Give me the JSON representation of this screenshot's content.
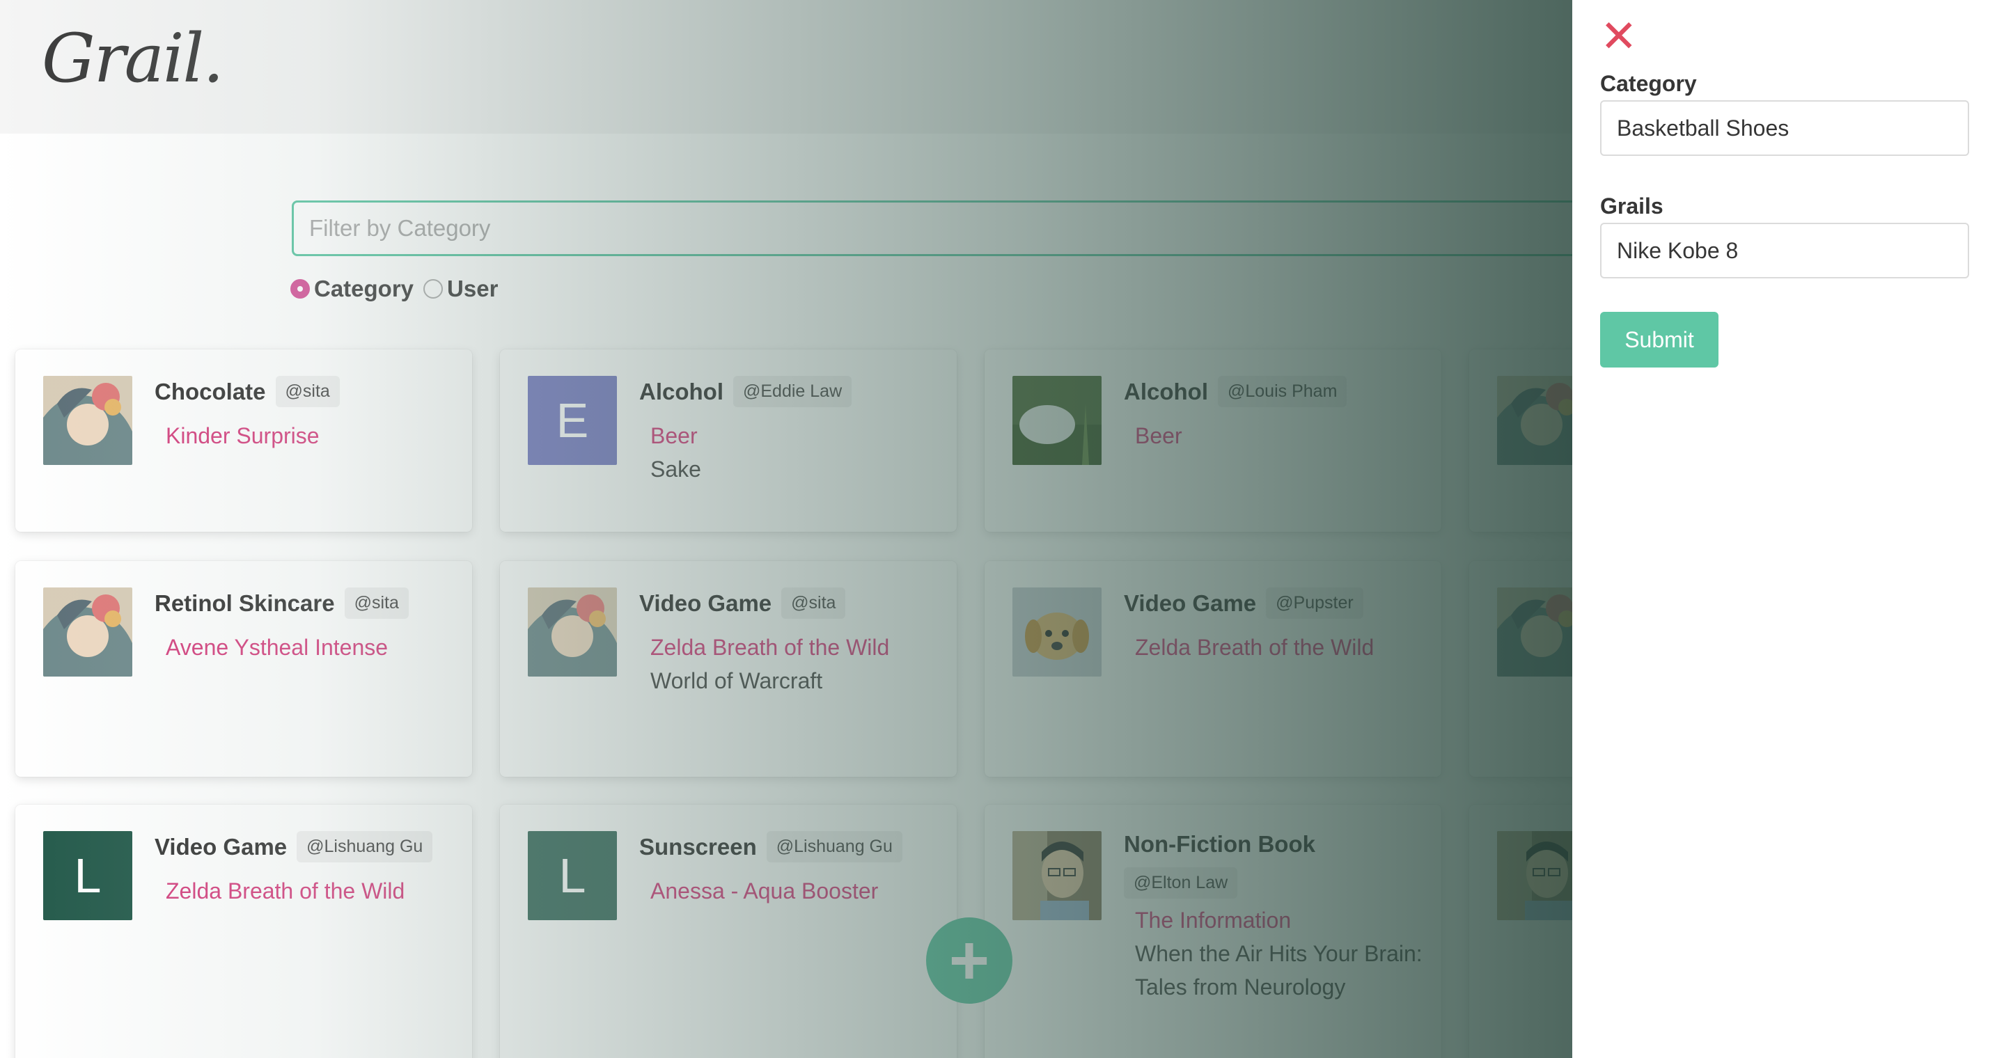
{
  "brand": {
    "logo": "Grail."
  },
  "search": {
    "placeholder": "Filter by Category"
  },
  "filter_options": [
    {
      "label": "Category",
      "selected": true
    },
    {
      "label": "User",
      "selected": false
    }
  ],
  "cards": [
    {
      "category": "Chocolate",
      "user": "@sita",
      "avatar": {
        "type": "photo",
        "icon": "illustrated-woman-avatar"
      },
      "items": [
        "Kinder Surprise"
      ]
    },
    {
      "category": "Alcohol",
      "user": "@Eddie Law",
      "avatar": {
        "type": "letter",
        "letter": "E",
        "color": "#7b7fc4"
      },
      "items": [
        "Beer",
        "Sake"
      ]
    },
    {
      "category": "Alcohol",
      "user": "@Louis Pham",
      "avatar": {
        "type": "photo",
        "icon": "nature-photo-avatar"
      },
      "items": [
        "Beer"
      ]
    },
    {
      "category": "Retinol Skincare",
      "user": "@sita",
      "avatar": {
        "type": "photo",
        "icon": "illustrated-woman-avatar"
      },
      "items": [
        "Avene Ystheal Intense"
      ]
    },
    {
      "category": "Video Game",
      "user": "@sita",
      "avatar": {
        "type": "photo",
        "icon": "illustrated-woman-avatar"
      },
      "items": [
        "Zelda Breath of the Wild",
        "World of Warcraft"
      ]
    },
    {
      "category": "Video Game",
      "user": "@Pupster",
      "avatar": {
        "type": "photo",
        "icon": "puppy-photo-avatar"
      },
      "items": [
        "Zelda Breath of the Wild"
      ]
    },
    {
      "category": "Video Game",
      "user": "@Lishuang Gu",
      "avatar": {
        "type": "letter",
        "letter": "L",
        "color": "#245a4b"
      },
      "items": [
        "Zelda Breath of the Wild"
      ]
    },
    {
      "category": "Sunscreen",
      "user": "@Lishuang Gu",
      "avatar": {
        "type": "letter",
        "letter": "L",
        "color": "#3f6f62"
      },
      "items": [
        "Anessa - Aqua Booster"
      ]
    },
    {
      "category": "Non-Fiction Book",
      "user": "@Elton Law",
      "avatar": {
        "type": "photo",
        "icon": "man-photo-avatar"
      },
      "items": [
        "The Information",
        "When the Air Hits Your Brain: Tales from Neurology"
      ]
    }
  ],
  "fab": {
    "icon": "plus-icon",
    "label": "+"
  },
  "panel": {
    "close_icon": "close-icon",
    "close_glyph": "✕",
    "category_label": "Category",
    "category_value": "Basketball Shoes",
    "grails_label": "Grails",
    "grails_value": "Nike Kobe 8",
    "submit_label": "Submit"
  },
  "colors": {
    "accent": "#5fc7a5",
    "pink": "#d6407f",
    "close": "#e04a5f"
  }
}
